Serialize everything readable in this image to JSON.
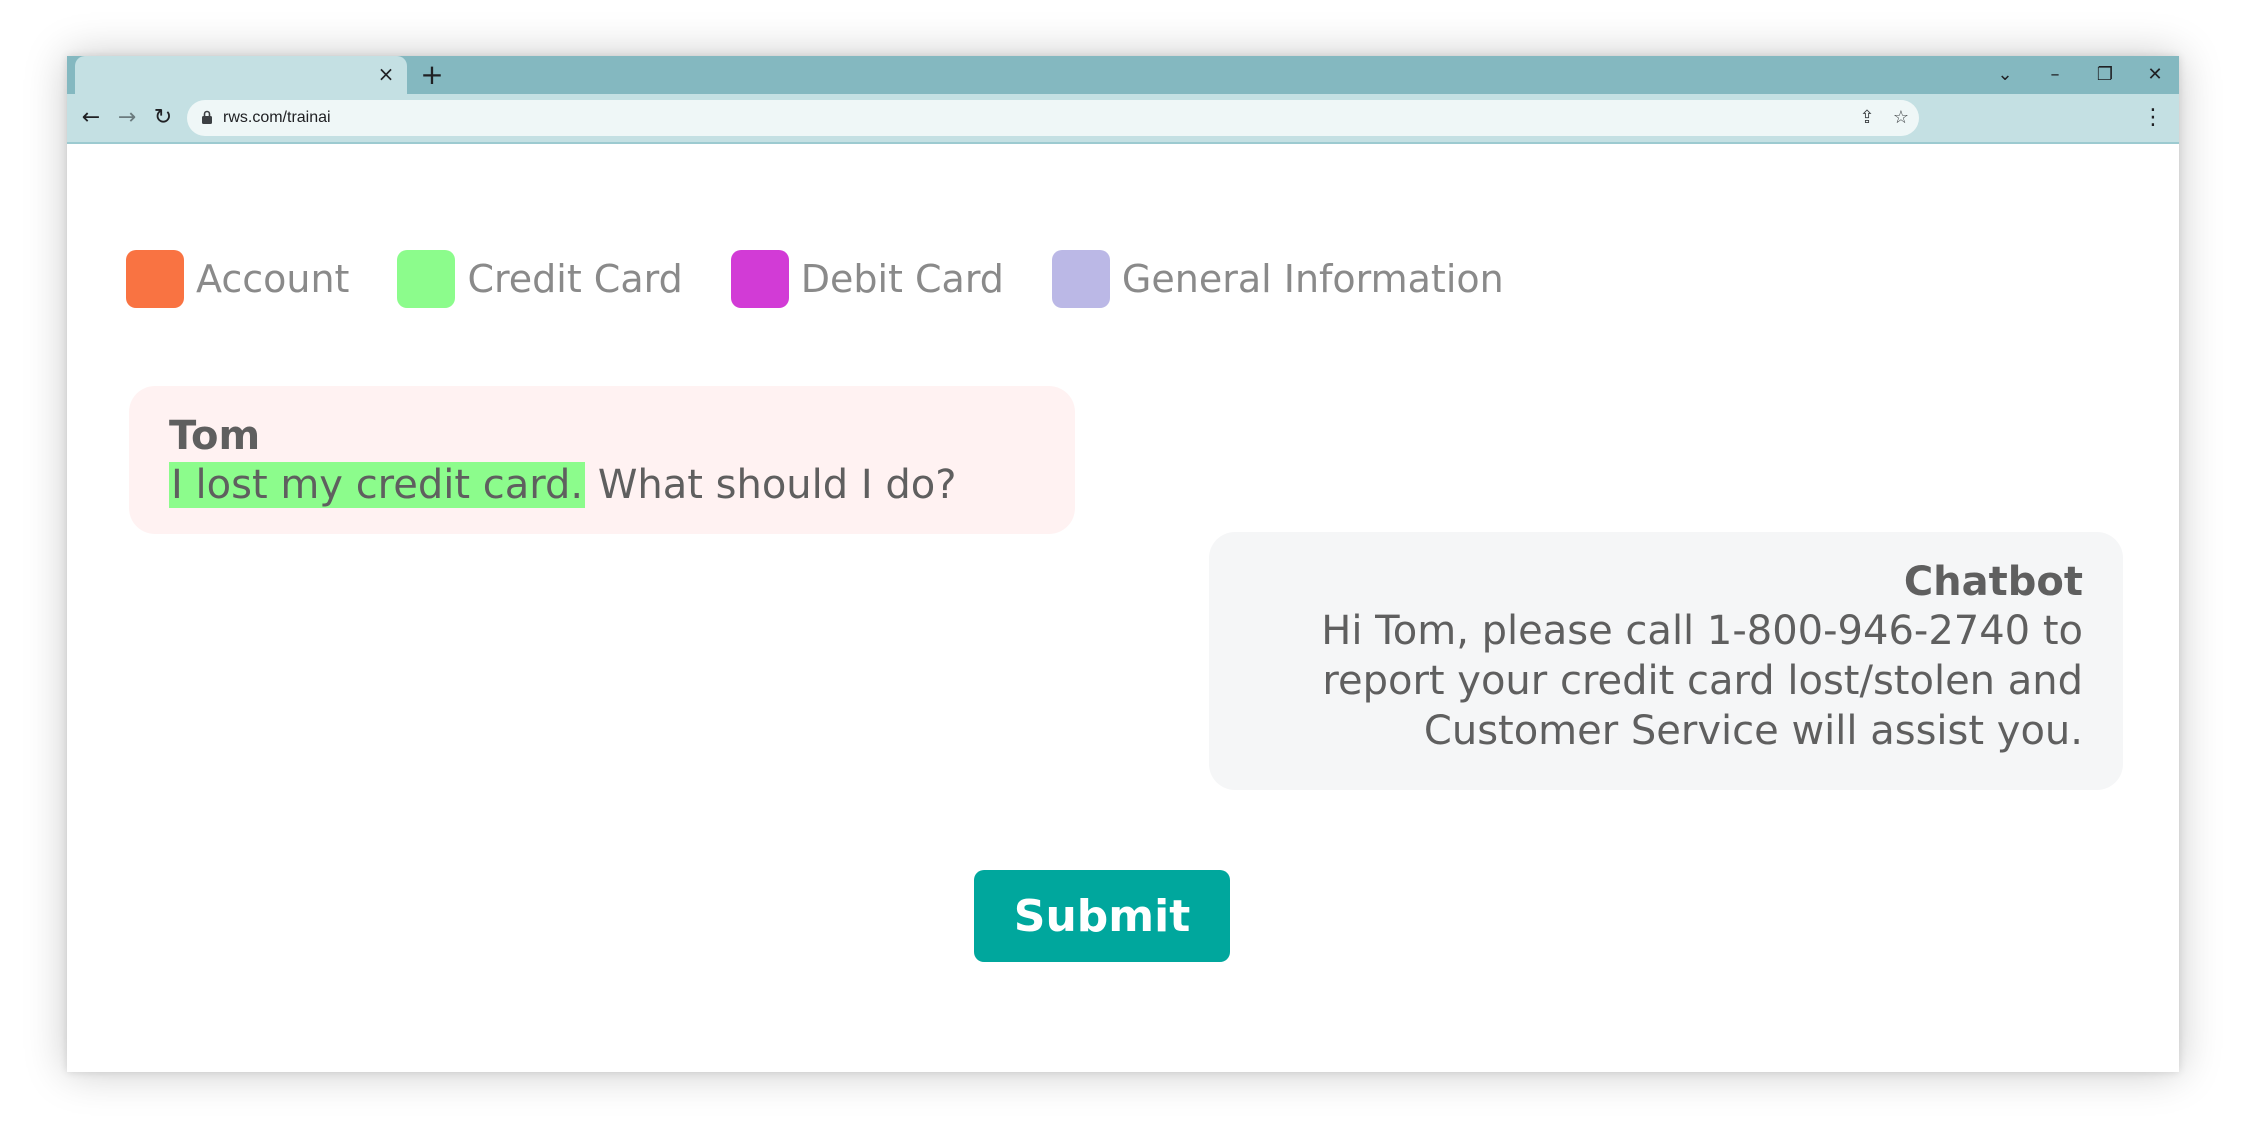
{
  "browser": {
    "tab_close": "×",
    "new_tab": "+",
    "url": "rws.com/trainai",
    "controls": {
      "tab_search": "⌄",
      "minimize": "–",
      "restore": "❐",
      "close": "✕"
    },
    "nav": {
      "back": "←",
      "forward": "→",
      "reload": "↻",
      "share": "⇪",
      "bookmark": "☆",
      "menu": "⋮"
    }
  },
  "legend": [
    {
      "label": "Account",
      "color": "#f97342"
    },
    {
      "label": "Credit Card",
      "color": "#8cfc8c"
    },
    {
      "label": "Debit Card",
      "color": "#d23bd6"
    },
    {
      "label": "General Information",
      "color": "#bbb8e6"
    }
  ],
  "conversation": {
    "user": {
      "speaker": "Tom",
      "highlighted_text": "I lost my credit card.",
      "highlight_category": "Credit Card",
      "rest_text": " What should I do?"
    },
    "bot": {
      "speaker": "Chatbot",
      "lines": [
        "Hi Tom, please call 1-800-946-2740 to",
        "report your credit card lost/stolen and",
        "Customer Service will assist you."
      ]
    }
  },
  "submit_label": "Submit",
  "colors": {
    "accent": "#00a79d",
    "tab_strip": "#84b8c0",
    "toolbar": "#c4e0e3"
  }
}
